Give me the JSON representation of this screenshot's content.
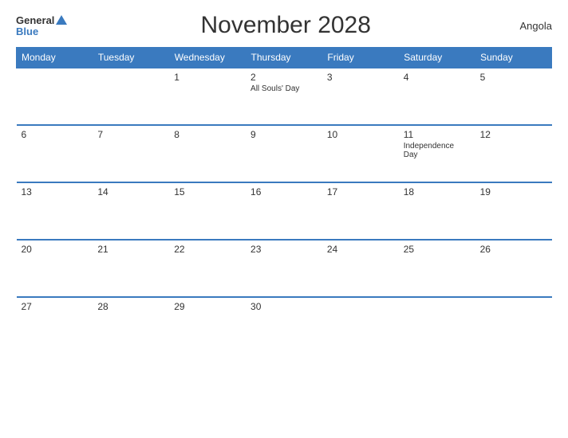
{
  "header": {
    "title": "November 2028",
    "country": "Angola",
    "logo_general": "General",
    "logo_blue": "Blue"
  },
  "weekdays": [
    "Monday",
    "Tuesday",
    "Wednesday",
    "Thursday",
    "Friday",
    "Saturday",
    "Sunday"
  ],
  "weeks": [
    [
      {
        "day": "",
        "event": ""
      },
      {
        "day": "",
        "event": ""
      },
      {
        "day": "1",
        "event": ""
      },
      {
        "day": "2",
        "event": "All Souls' Day"
      },
      {
        "day": "3",
        "event": ""
      },
      {
        "day": "4",
        "event": ""
      },
      {
        "day": "5",
        "event": ""
      }
    ],
    [
      {
        "day": "6",
        "event": ""
      },
      {
        "day": "7",
        "event": ""
      },
      {
        "day": "8",
        "event": ""
      },
      {
        "day": "9",
        "event": ""
      },
      {
        "day": "10",
        "event": ""
      },
      {
        "day": "11",
        "event": "Independence Day"
      },
      {
        "day": "12",
        "event": ""
      }
    ],
    [
      {
        "day": "13",
        "event": ""
      },
      {
        "day": "14",
        "event": ""
      },
      {
        "day": "15",
        "event": ""
      },
      {
        "day": "16",
        "event": ""
      },
      {
        "day": "17",
        "event": ""
      },
      {
        "day": "18",
        "event": ""
      },
      {
        "day": "19",
        "event": ""
      }
    ],
    [
      {
        "day": "20",
        "event": ""
      },
      {
        "day": "21",
        "event": ""
      },
      {
        "day": "22",
        "event": ""
      },
      {
        "day": "23",
        "event": ""
      },
      {
        "day": "24",
        "event": ""
      },
      {
        "day": "25",
        "event": ""
      },
      {
        "day": "26",
        "event": ""
      }
    ],
    [
      {
        "day": "27",
        "event": ""
      },
      {
        "day": "28",
        "event": ""
      },
      {
        "day": "29",
        "event": ""
      },
      {
        "day": "30",
        "event": ""
      },
      {
        "day": "",
        "event": ""
      },
      {
        "day": "",
        "event": ""
      },
      {
        "day": "",
        "event": ""
      }
    ]
  ]
}
